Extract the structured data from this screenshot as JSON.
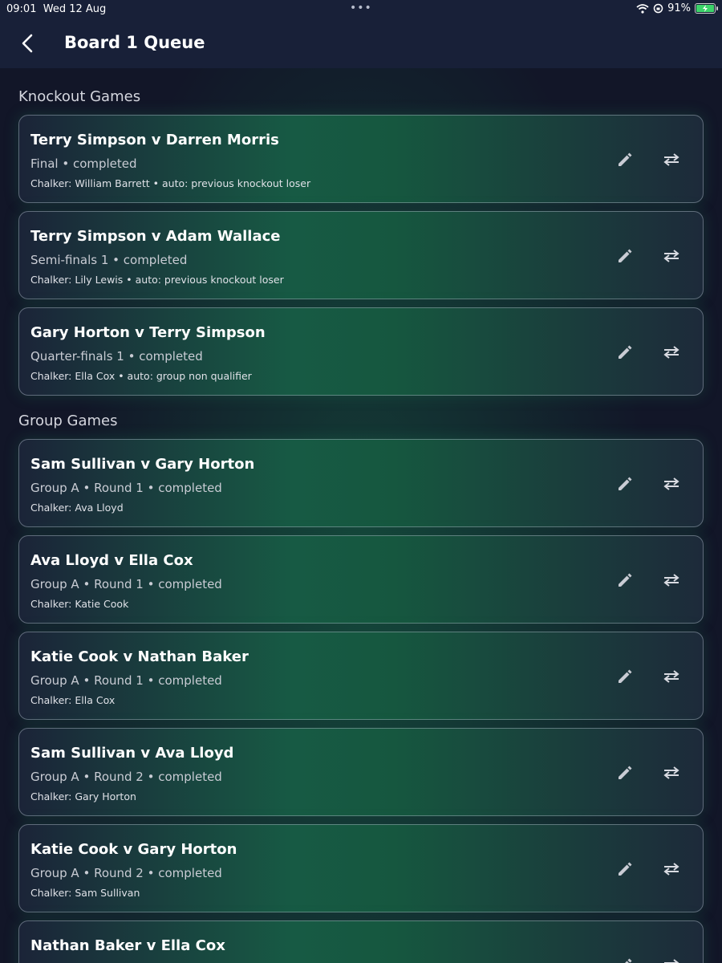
{
  "status_bar": {
    "time": "09:01",
    "date": "Wed 12 Aug",
    "dots": "•••",
    "battery": "91%"
  },
  "nav": {
    "title": "Board 1 Queue"
  },
  "sections": {
    "knockout_title": "Knockout Games",
    "group_title": "Group Games"
  },
  "knockout_games": [
    {
      "title": "Terry Simpson v Darren Morris",
      "sub": "Final • completed",
      "chalker": "Chalker: William Barrett • auto: previous knockout loser"
    },
    {
      "title": "Terry Simpson v Adam Wallace",
      "sub": "Semi-finals 1 • completed",
      "chalker": "Chalker: Lily Lewis • auto: previous knockout loser"
    },
    {
      "title": "Gary Horton v Terry Simpson",
      "sub": "Quarter-finals 1 • completed",
      "chalker": "Chalker: Ella Cox • auto: group non qualifier"
    }
  ],
  "group_games": [
    {
      "title": "Sam Sullivan v Gary Horton",
      "sub": "Group A • Round 1 • completed",
      "chalker": "Chalker: Ava Lloyd"
    },
    {
      "title": "Ava Lloyd v Ella Cox",
      "sub": "Group A • Round 1 • completed",
      "chalker": "Chalker: Katie Cook"
    },
    {
      "title": "Katie Cook v Nathan Baker",
      "sub": "Group A • Round 1 • completed",
      "chalker": "Chalker: Ella Cox"
    },
    {
      "title": "Sam Sullivan v Ava Lloyd",
      "sub": "Group A • Round 2 • completed",
      "chalker": "Chalker: Gary Horton"
    },
    {
      "title": "Katie Cook v Gary Horton",
      "sub": "Group A • Round 2 • completed",
      "chalker": "Chalker: Sam Sullivan"
    },
    {
      "title": "Nathan Baker v Ella Cox",
      "sub": "",
      "chalker": ""
    }
  ],
  "colors": {
    "accent_green": "#175a44",
    "nav_bg": "#182038",
    "battery_green": "#3cd36a"
  },
  "icons": {
    "edit": "pencil-icon",
    "swap": "swap-arrows-icon",
    "back": "chevron-left-icon"
  }
}
